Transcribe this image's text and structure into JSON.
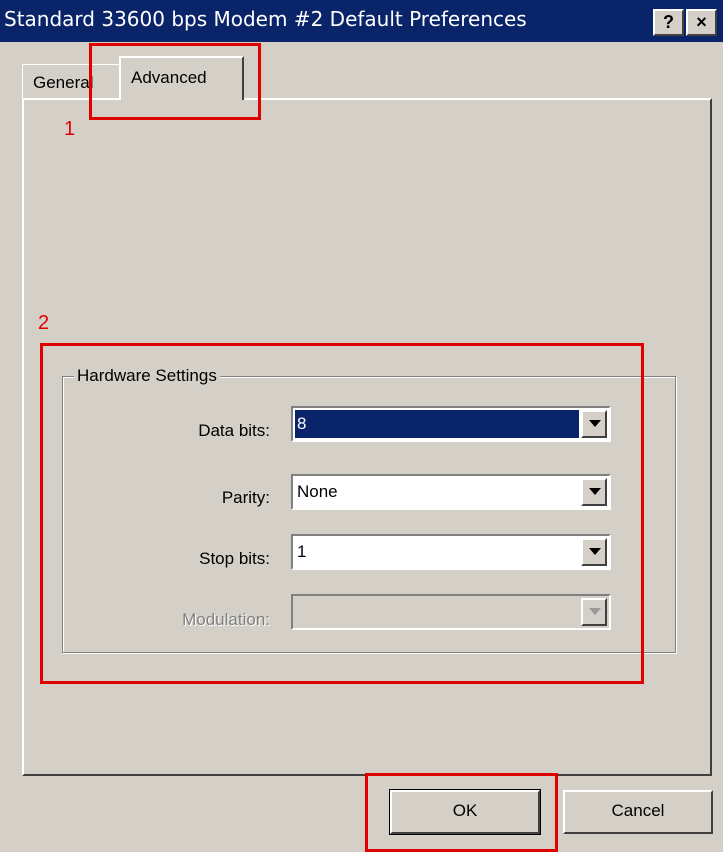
{
  "window": {
    "title": "Standard 33600 bps Modem #2 Default Preferences"
  },
  "titlebar_buttons": {
    "help": "?",
    "close": "×"
  },
  "tabs": [
    {
      "label": "General"
    },
    {
      "label": "Advanced"
    }
  ],
  "hardware": {
    "title": "Hardware Settings",
    "data_bits": {
      "label": "Data bits:",
      "value": "8"
    },
    "parity": {
      "label": "Parity:",
      "value": "None"
    },
    "stop_bits": {
      "label": "Stop bits:",
      "value": "1"
    },
    "modulation": {
      "label": "Modulation:",
      "value": ""
    }
  },
  "buttons": {
    "ok": "OK",
    "cancel": "Cancel"
  },
  "annotations": {
    "marker1": "1",
    "marker2": "2"
  },
  "colors": {
    "titlebar": "#0a246a",
    "face": "#d4d0c8",
    "highlight": "#e00000"
  }
}
